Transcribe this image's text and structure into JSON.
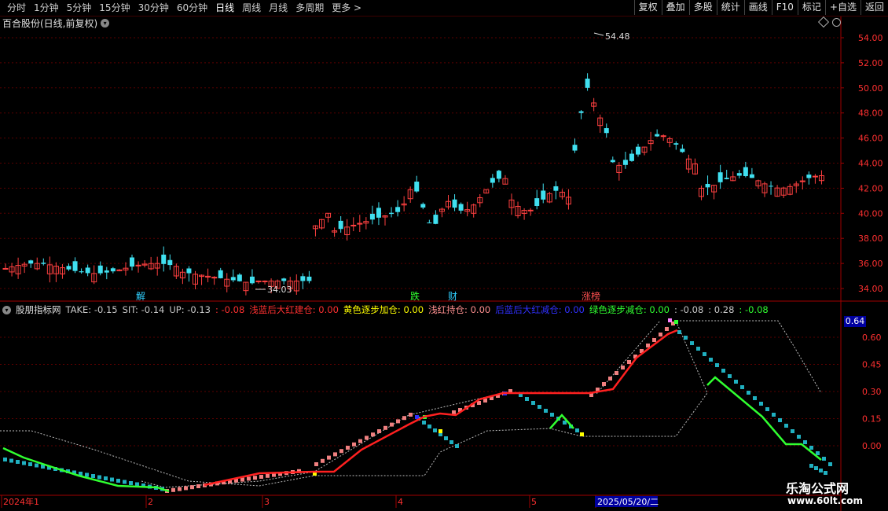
{
  "toolbar": {
    "periods": [
      "分时",
      "1分钟",
      "5分钟",
      "15分钟",
      "30分钟",
      "60分钟",
      "日线",
      "周线",
      "月线",
      "多周期",
      "更多"
    ],
    "active_period": "日线",
    "right_buttons": [
      "复权",
      "叠加",
      "多股",
      "统计",
      "画线",
      "F10",
      "标记",
      "+自选",
      "返回"
    ]
  },
  "chart_title": "百合股份(日线,前复权)",
  "indicator": {
    "name": "股朋指标网",
    "items": [
      {
        "label": "TAKE: -0.15",
        "color": "#c8c8c8"
      },
      {
        "label": "SIT: -0.14",
        "color": "#c8c8c8"
      },
      {
        "label": "UP: -0.13",
        "color": "#c8c8c8"
      },
      {
        "label": ": -0.08",
        "color": "#ff3030"
      },
      {
        "label": "浅蓝后大红建仓: 0.00",
        "color": "#ff3030"
      },
      {
        "label": "黄色逐步加仓: 0.00",
        "color": "#ffff00"
      },
      {
        "label": "浅红持仓: 0.00",
        "color": "#ff9090"
      },
      {
        "label": "后蓝后大红减仓: 0.00",
        "color": "#3030ff"
      },
      {
        "label": "绿色逐步减仓: 0.00",
        "color": "#30ff30"
      },
      {
        "label": ": -0.08",
        "color": "#c8c8c8"
      },
      {
        "label": ": 0.28",
        "color": "#c8c8c8"
      },
      {
        "label": ": -0.08",
        "color": "#30ff30"
      }
    ],
    "current_value": "0.64"
  },
  "price_axis": [
    "54.00",
    "52.00",
    "50.00",
    "48.00",
    "46.00",
    "44.00",
    "42.00",
    "40.00",
    "38.00",
    "36.00",
    "34.00"
  ],
  "ind_axis": [
    "0.60",
    "0.45",
    "0.30",
    "0.15",
    "0.00"
  ],
  "price_annotations": {
    "high": "54.48",
    "low": "34.03"
  },
  "event_marks": [
    {
      "text": "解",
      "color": "#30d0ff"
    },
    {
      "text": "跌",
      "color": "#30ff30"
    },
    {
      "text": "财",
      "color": "#30d0ff"
    },
    {
      "text": "涨榜",
      "color": "#ff5050"
    }
  ],
  "date_axis": [
    "2024年1",
    "2",
    "3",
    "4",
    "5",
    "2025/05/20/二"
  ],
  "watermark": {
    "name": "乐淘公式网",
    "url": "www.60lt.com"
  }
}
